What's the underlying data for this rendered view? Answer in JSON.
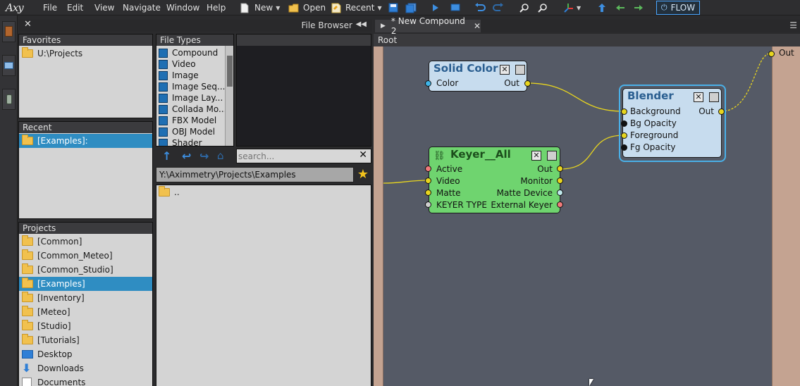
{
  "app": {
    "logo": "Axy"
  },
  "menubar": {
    "items": [
      "File",
      "Edit",
      "View",
      "Navigate",
      "Window",
      "Help"
    ],
    "new_label": "New",
    "open_label": "Open",
    "recent_label": "Recent",
    "flow_label": "FLOW"
  },
  "file_browser": {
    "title": "File Browser",
    "favorites": {
      "title": "Favorites",
      "items": [
        "U:\\Projects"
      ]
    },
    "recent": {
      "title": "Recent",
      "items": [
        "[Examples]:"
      ]
    },
    "file_types": {
      "title": "File Types",
      "items": [
        "Compound",
        "Video",
        "Image",
        "Image Seq...",
        "Image Lay...",
        "Collada Mo...",
        "FBX Model",
        "OBJ Model",
        "Shader"
      ]
    },
    "search_placeholder": "search...",
    "path": "Y:\\Aximmetry\\Projects\\Examples",
    "files": [
      ".."
    ],
    "projects": {
      "title": "Projects",
      "items": [
        "[Common]",
        "[Common_Meteo]",
        "[Common_Studio]",
        "[Examples]",
        "[Inventory]",
        "[Meteo]",
        "[Studio]",
        "[Tutorials]",
        "Desktop",
        "Downloads",
        "Documents"
      ]
    }
  },
  "editor": {
    "tab_label": "* New Compound 2",
    "breadcrumb": "Root",
    "output_label": "Out",
    "nodes": {
      "solid_color": {
        "title": "Solid Color",
        "in": [
          "Color"
        ],
        "out": [
          "Out"
        ]
      },
      "keyer": {
        "title": "Keyer__All",
        "in": [
          "Active",
          "Video",
          "Matte",
          "KEYER TYPE"
        ],
        "out": [
          "Out",
          "Monitor",
          "Matte Device",
          "External Keyer"
        ]
      },
      "blender": {
        "title": "Blender",
        "in": [
          "Background",
          "Bg Opacity",
          "Foreground",
          "Fg Opacity"
        ],
        "out": [
          "Out"
        ]
      }
    }
  },
  "colors": {
    "accent": "#4aa6ff",
    "selection": "#2f8dc2",
    "node_solid": "#c7dcee",
    "node_keyer": "#6fd46f",
    "wire": "#e8d51f"
  }
}
